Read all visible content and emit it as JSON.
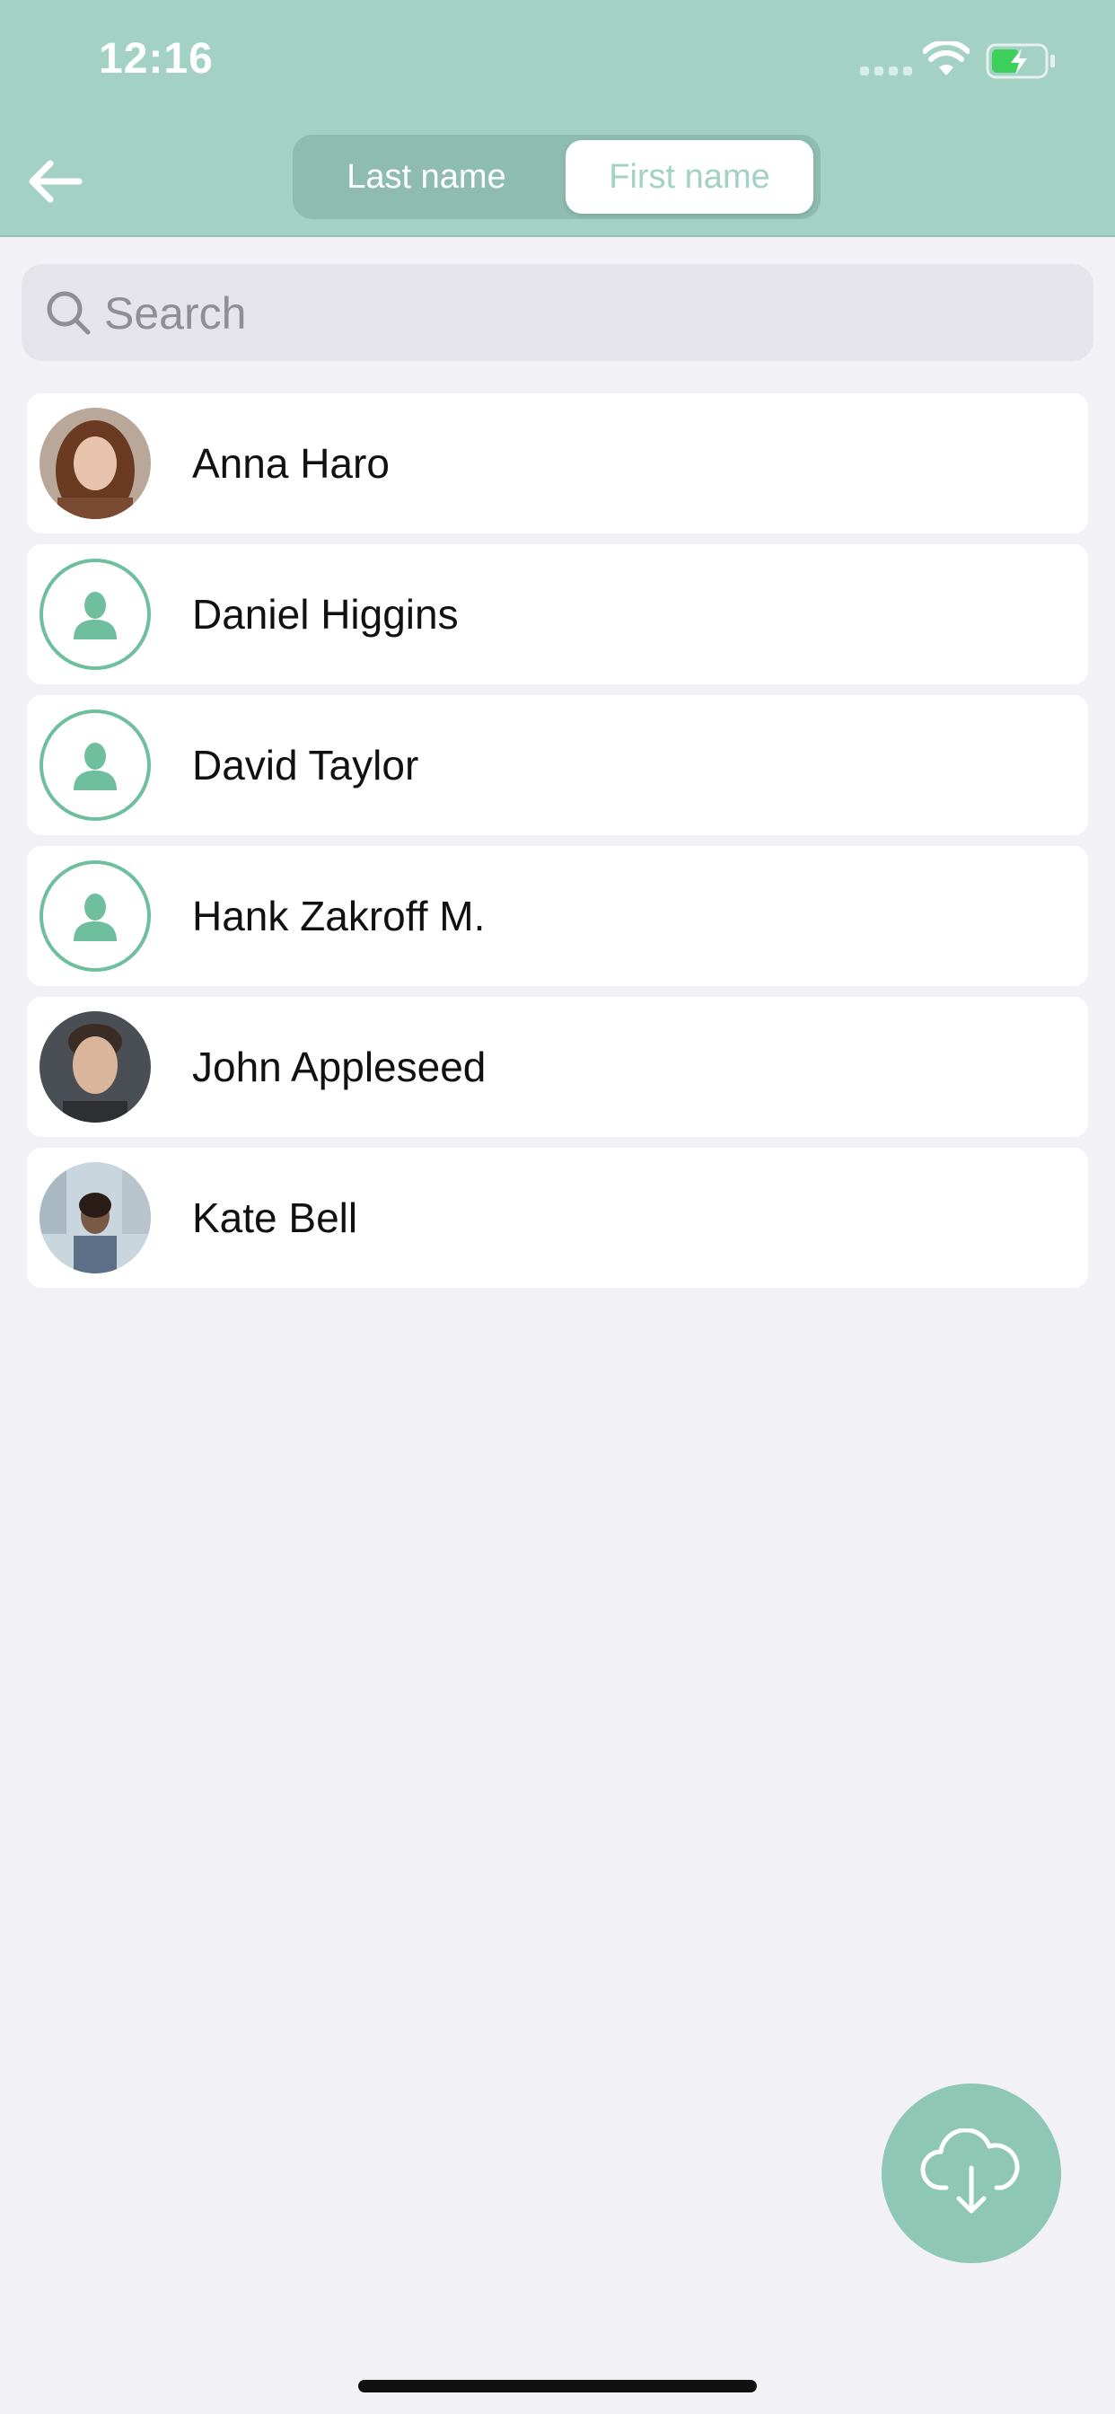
{
  "status_bar": {
    "time": "12:16"
  },
  "header": {
    "segments": [
      {
        "label": "Last name",
        "selected": false
      },
      {
        "label": "First name",
        "selected": true
      }
    ]
  },
  "search": {
    "placeholder": "Search",
    "value": ""
  },
  "contacts": [
    {
      "name": "Anna Haro",
      "avatar": "photo"
    },
    {
      "name": "Daniel Higgins",
      "avatar": "person-icon"
    },
    {
      "name": "David Taylor",
      "avatar": "person-icon"
    },
    {
      "name": "Hank Zakroff M.",
      "avatar": "person-icon"
    },
    {
      "name": "John Appleseed",
      "avatar": "photo"
    },
    {
      "name": "Kate Bell",
      "avatar": "photo"
    }
  ],
  "fab": {
    "icon": "cloud-download-icon"
  },
  "colors": {
    "header": "#a3d1c4",
    "accent": "#6fbf9f",
    "fab": "#8ec7b3",
    "background": "#f1f1f6"
  }
}
